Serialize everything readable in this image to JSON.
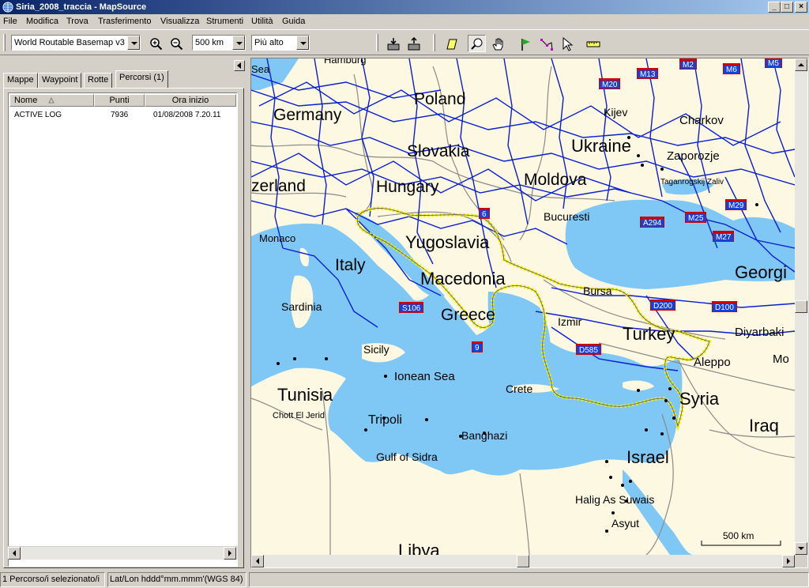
{
  "window": {
    "title": "Siria_2008_traccia - MapSource",
    "buttons": [
      "_",
      "□",
      "×"
    ]
  },
  "menu": [
    "File",
    "Modifica",
    "Trova",
    "Trasferimento",
    "Visualizza",
    "Strumenti",
    "Utilità",
    "Guida"
  ],
  "toolbar": {
    "map_product": "World Routable Basemap v3",
    "zoom_scale": "500 km",
    "detail": "Più alto"
  },
  "left_panel": {
    "tabs": [
      "Mappe",
      "Waypoint",
      "Rotte",
      "Percorsi (1)"
    ],
    "active_tab": "Percorsi (1)",
    "columns": [
      "Nome",
      "Punti",
      "Ora inizio"
    ],
    "rows": [
      {
        "name": "ACTIVE LOG",
        "points": "7936",
        "start": "01/08/2008 7.20.11"
      }
    ]
  },
  "map": {
    "labels_large": [
      "Poland",
      "Germany",
      "Slovakia",
      "Ukraine",
      "zerland",
      "Hungary",
      "Moldova",
      "Yugoslavia",
      "Macedonia",
      "Italy",
      "Greece",
      "Turkey",
      "Tunisia",
      "Syria",
      "Iraq",
      "Israel",
      "Libya",
      "Georgi"
    ],
    "labels_small": [
      "Sea",
      "Hamburg",
      "Kijev",
      "Charkov",
      "Zaporozje",
      "Taganrogskij Zaliv",
      "Bucuresti",
      "Monaco",
      "Sardinia",
      "Sicily",
      "Ionean Sea",
      "Crete",
      "Tripoli",
      "Banghazi",
      "Gulf of Sidra",
      "Chott El Jerid",
      "Halig As Suwais",
      "Asyut",
      "Bursa",
      "Izmir",
      "Aleppo",
      "Diyarbaki",
      "Mo"
    ],
    "road_shields": [
      "M20",
      "M13",
      "M2",
      "M6",
      "M5",
      "6",
      "A294",
      "M25",
      "M29",
      "M27",
      "S106",
      "9",
      "D585",
      "D200",
      "D100"
    ],
    "scale_label": "500 km",
    "track_color": "#f5f000",
    "road_color": "#0a1fd0",
    "sea_color": "#7fc7f5",
    "land_color": "#fdf8e1"
  },
  "status": {
    "selection": "1 Percorso/i selezionato/i",
    "position_format": "Lat/Lon hddd°mm.mmm'(WGS 84)"
  }
}
